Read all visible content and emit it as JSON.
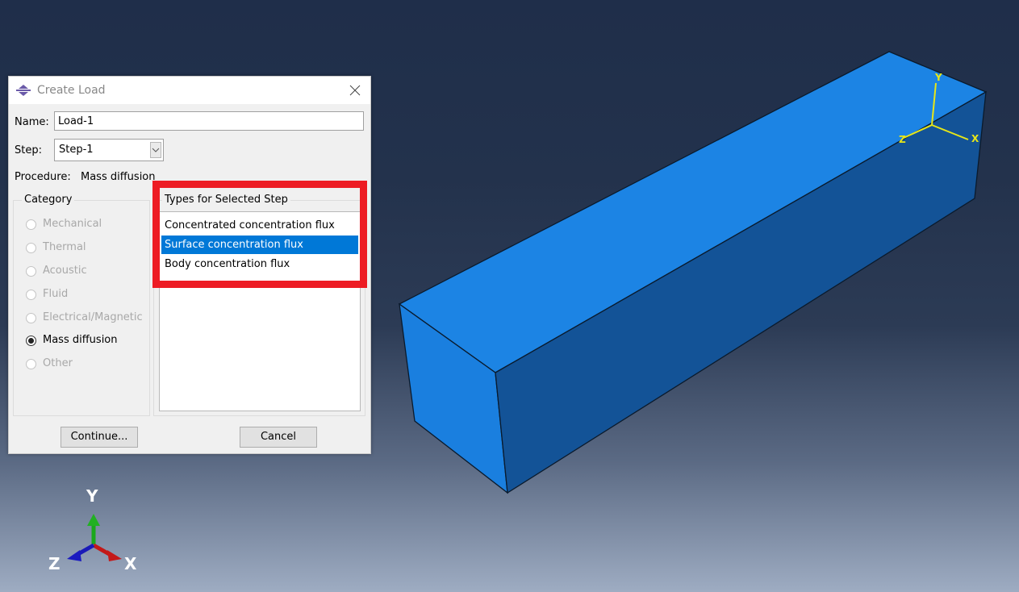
{
  "dialog": {
    "title": "Create Load",
    "name_label": "Name:",
    "name_value": "Load-1",
    "step_label": "Step:",
    "step_value": "Step-1",
    "procedure_label": "Procedure:",
    "procedure_value": "Mass diffusion",
    "category": {
      "title": "Category",
      "options": [
        {
          "label": "Mechanical",
          "selected": false,
          "enabled": false
        },
        {
          "label": "Thermal",
          "selected": false,
          "enabled": false
        },
        {
          "label": "Acoustic",
          "selected": false,
          "enabled": false
        },
        {
          "label": "Fluid",
          "selected": false,
          "enabled": false
        },
        {
          "label": "Electrical/Magnetic",
          "selected": false,
          "enabled": false
        },
        {
          "label": "Mass diffusion",
          "selected": true,
          "enabled": true
        },
        {
          "label": "Other",
          "selected": false,
          "enabled": false
        }
      ]
    },
    "types": {
      "title": "Types for Selected Step",
      "items": [
        {
          "label": "Concentrated concentration flux",
          "selected": false
        },
        {
          "label": "Surface concentration flux",
          "selected": true
        },
        {
          "label": "Body concentration flux",
          "selected": false
        }
      ]
    },
    "continue_label": "Continue...",
    "cancel_label": "Cancel"
  },
  "viewport": {
    "model_triad": {
      "x": "X",
      "y": "Y",
      "z": "Z"
    },
    "global_triad": {
      "x": "X",
      "y": "Y",
      "z": "Z"
    },
    "colors": {
      "part_top": "#1c84e4",
      "part_front": "#1a7fdf",
      "part_side": "#135397",
      "highlight": "#ed1c24",
      "selection": "#0078d7",
      "triad_model": "#e6e619"
    }
  }
}
